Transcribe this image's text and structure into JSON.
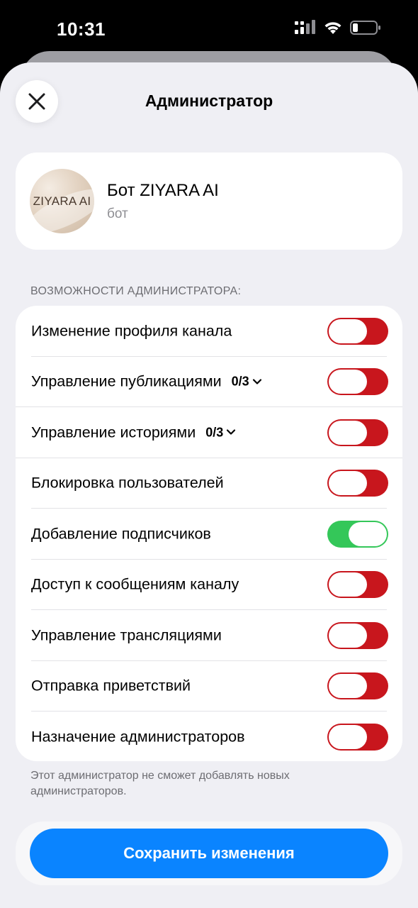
{
  "status": {
    "time": "10:31"
  },
  "sheet": {
    "title": "Администратор"
  },
  "profile": {
    "avatar_text": "ZIYARA AI",
    "name": "Бот ZIYARA AI",
    "subtitle": "бот"
  },
  "permissions": {
    "header": "ВОЗМОЖНОСТИ АДМИНИСТРАТОРА:",
    "items": [
      {
        "label": "Изменение профиля канала",
        "count": "",
        "enabled": false
      },
      {
        "label": "Управление публикациями",
        "count": "0/3",
        "enabled": false
      },
      {
        "label": "Управление историями",
        "count": "0/3",
        "enabled": false
      },
      {
        "label": "Блокировка пользователей",
        "count": "",
        "enabled": false
      },
      {
        "label": "Добавление подписчиков",
        "count": "",
        "enabled": true
      },
      {
        "label": "Доступ к сообщениям каналу",
        "count": "",
        "enabled": false
      },
      {
        "label": "Управление трансляциями",
        "count": "",
        "enabled": false
      },
      {
        "label": "Отправка приветствий",
        "count": "",
        "enabled": false
      },
      {
        "label": "Назначение администраторов",
        "count": "",
        "enabled": false
      }
    ],
    "footnote": "Этот администратор не сможет добавлять новых администраторов."
  },
  "actions": {
    "save_label": "Сохранить изменения"
  },
  "colors": {
    "accent": "#0a84ff",
    "toggle_off": "#c8161d",
    "toggle_on": "#34c759"
  }
}
